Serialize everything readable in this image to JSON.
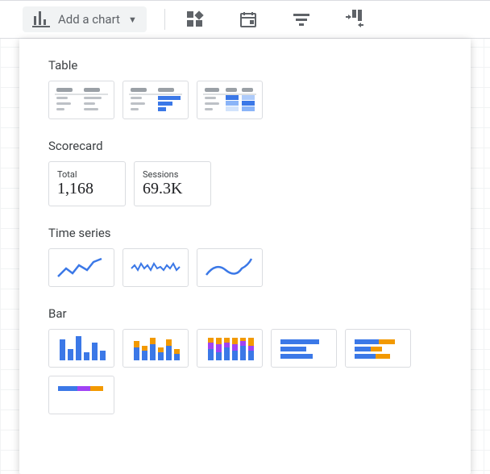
{
  "toolbar": {
    "add_chart_label": "Add a chart"
  },
  "dropdown": {
    "sections": {
      "table": "Table",
      "scorecard": "Scorecard",
      "time_series": "Time series",
      "bar": "Bar"
    },
    "scorecards": [
      {
        "label": "Total",
        "value": "1,168"
      },
      {
        "label": "Sessions",
        "value": "69.3K"
      }
    ]
  }
}
